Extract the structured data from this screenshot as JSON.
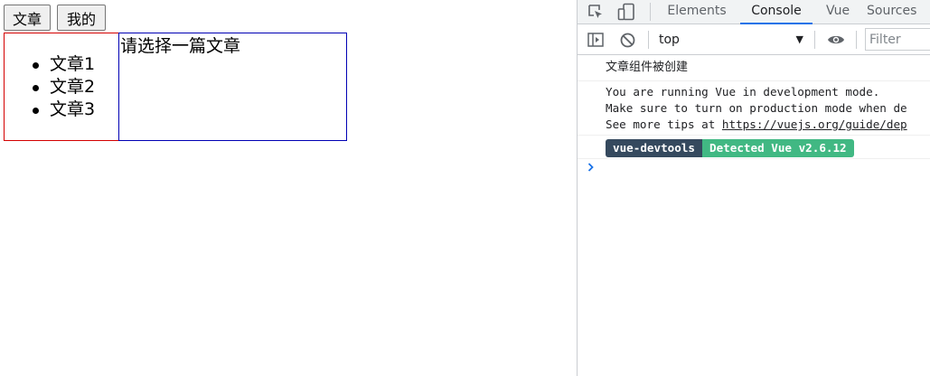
{
  "page": {
    "nav": {
      "articles_label": "文章",
      "mine_label": "我的"
    },
    "article_list": [
      "文章1",
      "文章2",
      "文章3"
    ],
    "detail_placeholder": "请选择一篇文章"
  },
  "devtools": {
    "tabs": [
      "Elements",
      "Console",
      "Vue",
      "Sources"
    ],
    "active_tab": "Console",
    "context": "top",
    "filter_placeholder": "Filter",
    "messages": {
      "created": "文章组件被创建",
      "vue_dev": [
        "You are running Vue in development mode.",
        "Make sure to turn on production mode when de",
        "See more tips at "
      ],
      "vue_link": "https://vuejs.org/guide/dep",
      "badge_devtools": "vue-devtools",
      "badge_detected": "Detected Vue v2.6.12"
    }
  },
  "colors": {
    "list_border": "#d40000",
    "detail_border": "#0000b4",
    "active_tab_underline": "#1a73e8",
    "badge_dark": "#35495e",
    "badge_green": "#41b883"
  },
  "icons": [
    "inspect-icon",
    "device-toggle-icon",
    "sidebar-toggle-icon",
    "clear-console-icon",
    "eye-icon",
    "console-prompt-icon"
  ]
}
